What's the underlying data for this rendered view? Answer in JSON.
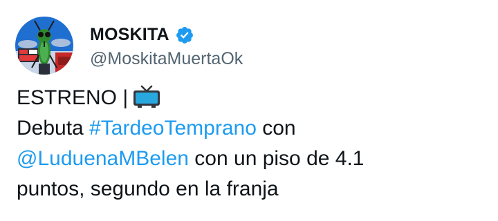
{
  "author": {
    "display_name": "MOSKITA",
    "handle": "@MoskitaMuertaOk",
    "verified": true,
    "avatar_icon": "mosquito-avatar-icon",
    "verified_icon": "verified-badge-icon"
  },
  "tweet": {
    "line1": "ESTRENO |",
    "line1_icon": "television-emoji-icon",
    "line2_prefix": "Debuta ",
    "hashtag": "#TardeoTemprano",
    "line2_suffix": " con",
    "mention": "@LuduenaMBelen",
    "line3_suffix": " con un piso de 4.1",
    "line4": "puntos, segundo en la franja"
  },
  "colors": {
    "link": "#1d9bf0",
    "text": "#0f1419",
    "secondary": "#536471",
    "verified": "#1d9bf0"
  }
}
